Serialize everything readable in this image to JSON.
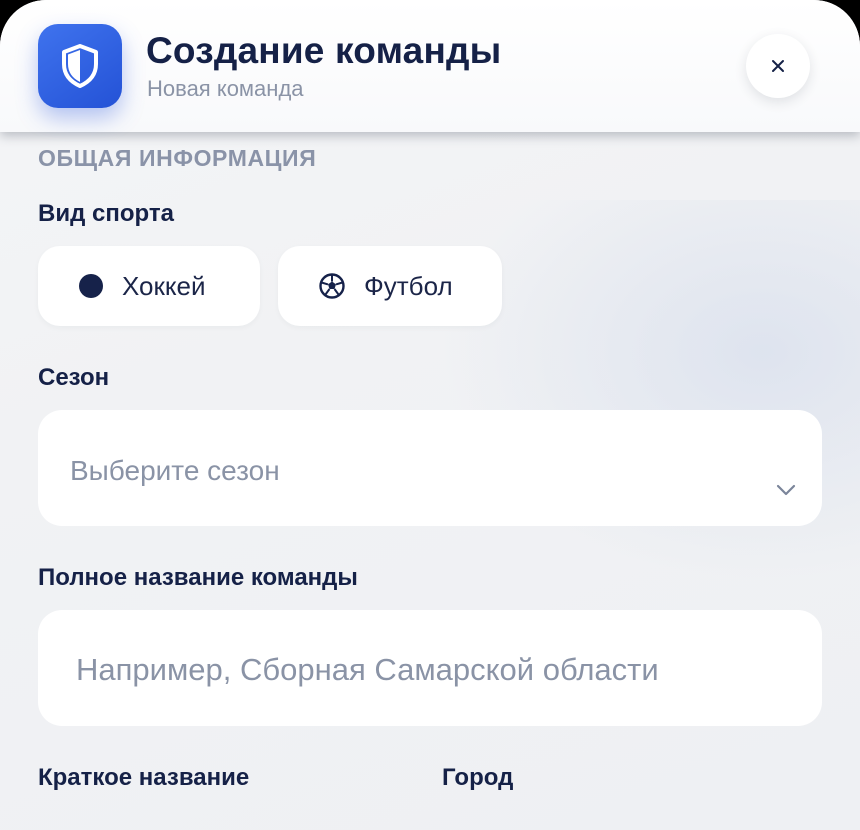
{
  "header": {
    "title": "Создание команды",
    "subtitle": "Новая команда",
    "app_icon": "shield-icon",
    "close_icon": "close-icon"
  },
  "form": {
    "section_title": "ОБЩАЯ ИНФОРМАЦИЯ",
    "sport": {
      "label": "Вид спорта",
      "options": [
        {
          "label": "Хоккей",
          "icon": "puck-icon"
        },
        {
          "label": "Футбол",
          "icon": "soccer-ball-icon"
        }
      ]
    },
    "season": {
      "label": "Сезон",
      "placeholder": "Выберите сезон",
      "icon": "chevron-down-icon"
    },
    "full_name": {
      "label": "Полное название команды",
      "placeholder": "Например, Сборная Самарской области"
    },
    "short_name": {
      "label": "Краткое название"
    },
    "city": {
      "label": "Город"
    }
  },
  "colors": {
    "accent": "#2f5fe0",
    "title": "#152147",
    "muted": "#8a93a6"
  }
}
